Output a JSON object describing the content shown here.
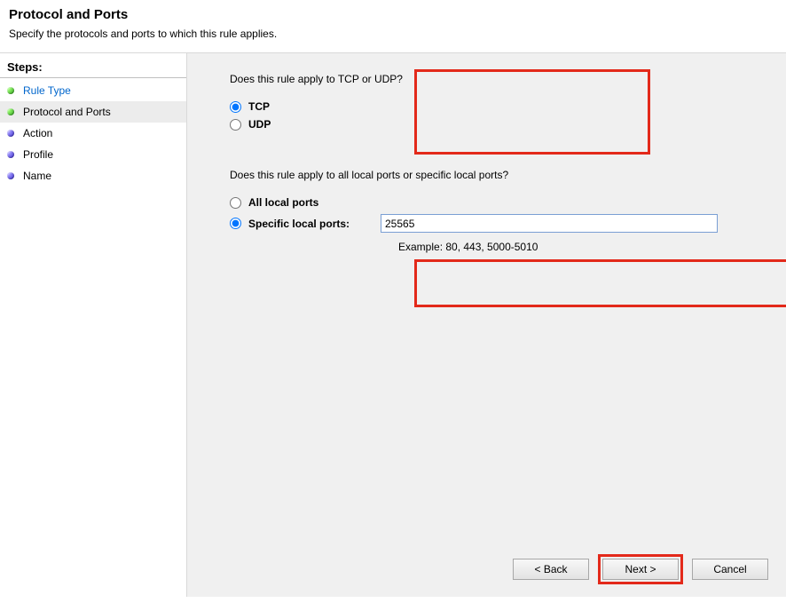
{
  "header": {
    "title": "Protocol and Ports",
    "subtitle": "Specify the protocols and ports to which this rule applies."
  },
  "sidebar": {
    "heading": "Steps:",
    "items": [
      {
        "label": "Rule Type",
        "dot": "green",
        "link": true,
        "current": false
      },
      {
        "label": "Protocol and Ports",
        "dot": "green",
        "link": false,
        "current": true
      },
      {
        "label": "Action",
        "dot": "purple",
        "link": false,
        "current": false
      },
      {
        "label": "Profile",
        "dot": "purple",
        "link": false,
        "current": false
      },
      {
        "label": "Name",
        "dot": "purple",
        "link": false,
        "current": false
      }
    ]
  },
  "main": {
    "protocol": {
      "question": "Does this rule apply to TCP or UDP?",
      "options": {
        "tcp": "TCP",
        "udp": "UDP"
      },
      "selected": "tcp"
    },
    "ports": {
      "question": "Does this rule apply to all local ports or specific local ports?",
      "options": {
        "all": "All local ports",
        "specific": "Specific local ports:"
      },
      "selected": "specific",
      "value": "25565",
      "example": "Example: 80, 443, 5000-5010"
    }
  },
  "buttons": {
    "back": "< Back",
    "next": "Next >",
    "cancel": "Cancel"
  }
}
